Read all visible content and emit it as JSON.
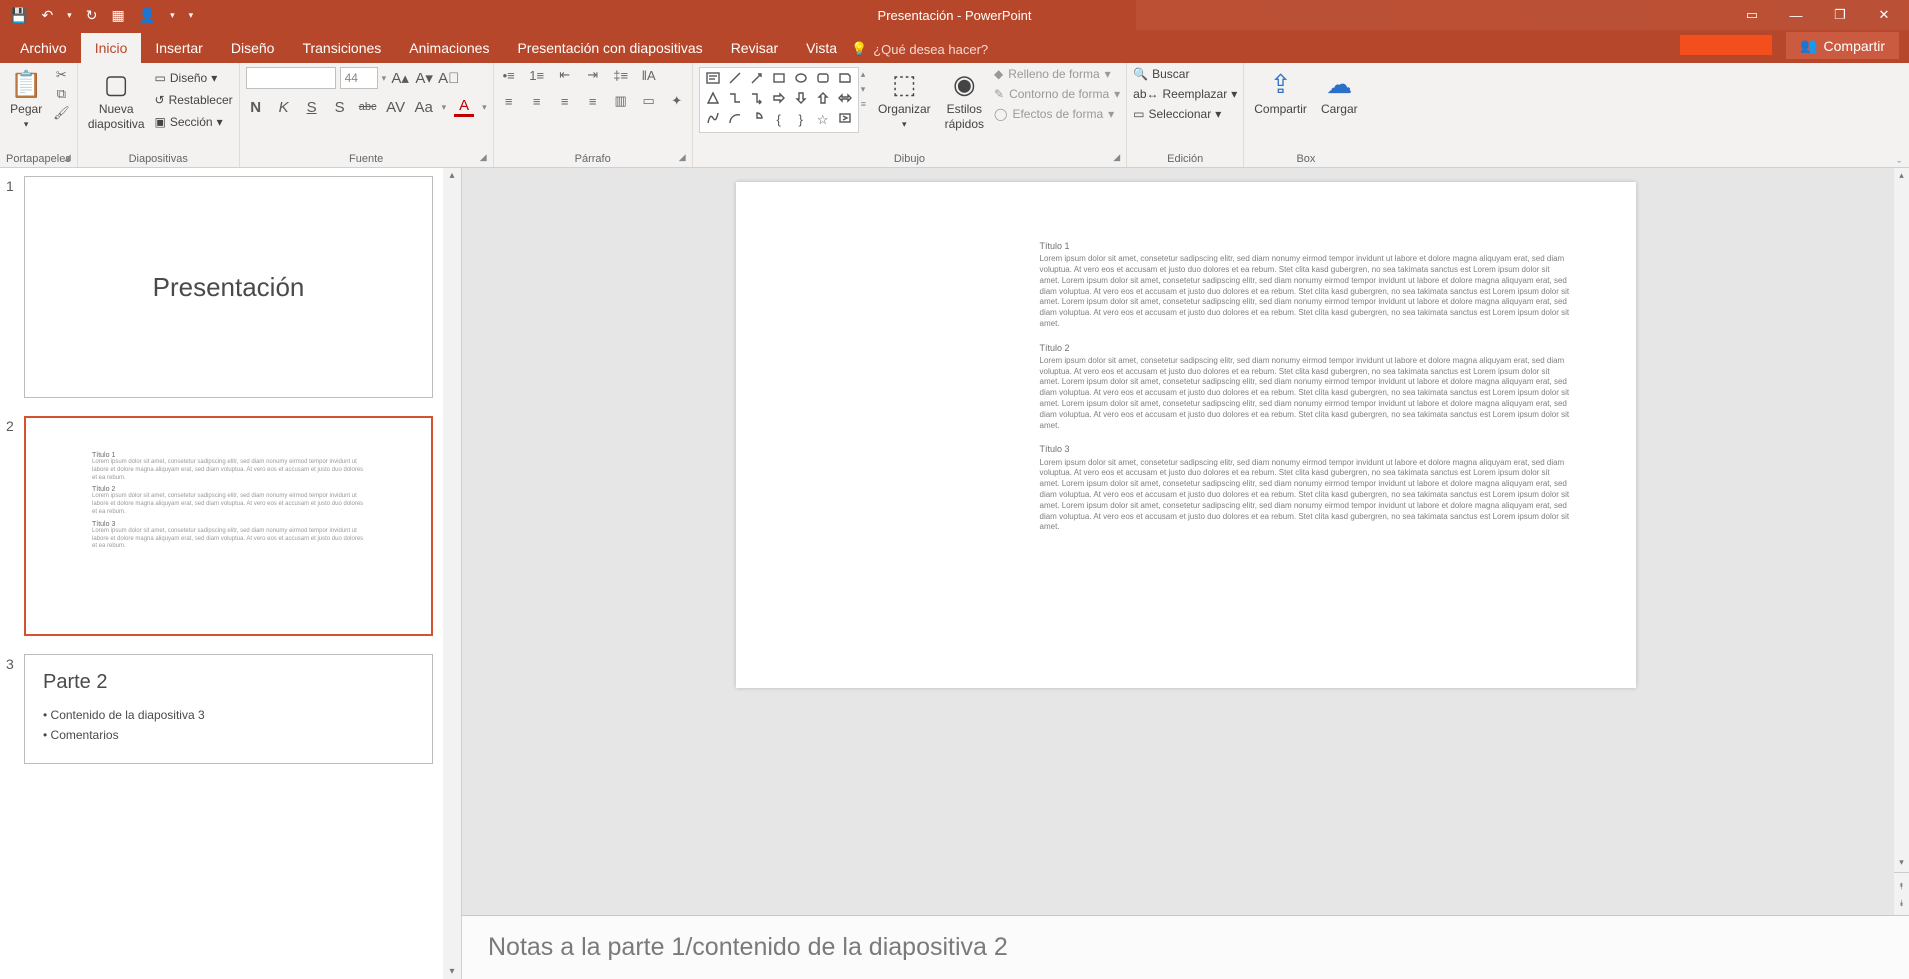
{
  "title": "Presentación - PowerPoint",
  "qat": {
    "save": "💾",
    "undo": "↶",
    "redo": "↻",
    "fromstart": "▦",
    "touch": "👤",
    "dd1": "▾",
    "dd2": "▾"
  },
  "win": {
    "ribbonopts": "▭",
    "min": "—",
    "max": "❐",
    "close": "✕"
  },
  "tabs": {
    "file": "Archivo",
    "home": "Inicio",
    "insert": "Insertar",
    "design": "Diseño",
    "transitions": "Transiciones",
    "animations": "Animaciones",
    "slideshow": "Presentación con diapositivas",
    "review": "Revisar",
    "view": "Vista"
  },
  "tellme": {
    "icon": "💡",
    "text": "¿Qué desea hacer?"
  },
  "share": {
    "icon": "👥",
    "label": "Compartir"
  },
  "groups": {
    "clipboard": {
      "label": "Portapapeles",
      "paste": "Pegar",
      "cut": "✂",
      "copy": "⧉",
      "painter": "🖌"
    },
    "slides": {
      "label": "Diapositivas",
      "new": "Nueva\ndiapositiva",
      "layout": "Diseño",
      "reset": "Restablecer",
      "section": "Sección"
    },
    "font": {
      "label": "Fuente",
      "size": "44",
      "bold": "N",
      "italic": "K",
      "underline": "S",
      "shadow": "S",
      "strike": "abc",
      "spacing": "AV",
      "case": "Aa",
      "color": "A"
    },
    "paragraph": {
      "label": "Párrafo"
    },
    "drawing": {
      "label": "Dibujo",
      "arrange": "Organizar",
      "quickstyles": "Estilos\nrápidos",
      "fill": "Relleno de forma",
      "outline": "Contorno de forma",
      "effects": "Efectos de forma"
    },
    "editing": {
      "label": "Edición",
      "find": "Buscar",
      "replace": "Reemplazar",
      "select": "Seleccionar"
    },
    "box": {
      "label": "Box",
      "share": "Compartir",
      "upload": "Cargar"
    }
  },
  "thumbs": {
    "s1": {
      "num": "1",
      "title": "Presentación"
    },
    "s2": {
      "num": "2",
      "titles": [
        "Título 1",
        "Título 2",
        "Título 3"
      ],
      "body": "Lorem ipsum dolor sit amet, consetetur sadipscing elitr, sed diam nonumy eirmod tempor invidunt ut labore et dolore magna aliquyam erat, sed diam voluptua. At vero eos et accusam et justo duo dolores et ea rebum."
    },
    "s3": {
      "num": "3",
      "title": "Parte 2",
      "b1": "• Contenido de la diapositiva 3",
      "b2": "• Comentarios"
    }
  },
  "slide": {
    "t1": "Título 1",
    "b1": "Lorem ipsum dolor sit amet, consetetur sadipscing elitr, sed diam nonumy eirmod tempor invidunt ut labore et dolore magna aliquyam erat, sed diam voluptua. At vero eos et accusam et justo duo dolores et ea rebum. Stet clita kasd gubergren, no sea takimata sanctus est Lorem ipsum dolor sit amet. Lorem ipsum dolor sit amet, consetetur sadipscing elitr, sed diam nonumy eirmod tempor invidunt ut labore et dolore magna aliquyam erat, sed diam voluptua. At vero eos et accusam et justo duo dolores et ea rebum. Stet clita kasd gubergren, no sea takimata sanctus est Lorem ipsum dolor sit amet. Lorem ipsum dolor sit amet, consetetur sadipscing elitr, sed diam nonumy eirmod tempor invidunt ut labore et dolore magna aliquyam erat, sed diam voluptua. At vero eos et accusam et justo duo dolores et ea rebum. Stet clita kasd gubergren, no sea takimata sanctus est Lorem ipsum dolor sit amet.",
    "t2": "Título 2",
    "b2": "Lorem ipsum dolor sit amet, consetetur sadipscing elitr, sed diam nonumy eirmod tempor invidunt ut labore et dolore magna aliquyam erat, sed diam voluptua. At vero eos et accusam et justo duo dolores et ea rebum. Stet clita kasd gubergren, no sea takimata sanctus est Lorem ipsum dolor sit amet. Lorem ipsum dolor sit amet, consetetur sadipscing elitr, sed diam nonumy eirmod tempor invidunt ut labore et dolore magna aliquyam erat, sed diam voluptua. At vero eos et accusam et justo duo dolores et ea rebum. Stet clita kasd gubergren, no sea takimata sanctus est Lorem ipsum dolor sit amet. Lorem ipsum dolor sit amet, consetetur sadipscing elitr, sed diam nonumy eirmod tempor invidunt ut labore et dolore magna aliquyam erat, sed diam voluptua. At vero eos et accusam et justo duo dolores et ea rebum. Stet clita kasd gubergren, no sea takimata sanctus est Lorem ipsum dolor sit amet.",
    "t3": "Título 3",
    "b3": "Lorem ipsum dolor sit amet, consetetur sadipscing elitr, sed diam nonumy eirmod tempor invidunt ut labore et dolore magna aliquyam erat, sed diam voluptua. At vero eos et accusam et justo duo dolores et ea rebum. Stet clita kasd gubergren, no sea takimata sanctus est Lorem ipsum dolor sit amet. Lorem ipsum dolor sit amet, consetetur sadipscing elitr, sed diam nonumy eirmod tempor invidunt ut labore et dolore magna aliquyam erat, sed diam voluptua. At vero eos et accusam et justo duo dolores et ea rebum. Stet clita kasd gubergren, no sea takimata sanctus est Lorem ipsum dolor sit amet. Lorem ipsum dolor sit amet, consetetur sadipscing elitr, sed diam nonumy eirmod tempor invidunt ut labore et dolore magna aliquyam erat, sed diam voluptua. At vero eos et accusam et justo duo dolores et ea rebum. Stet clita kasd gubergren, no sea takimata sanctus est Lorem ipsum dolor sit amet."
  },
  "notes": "Notas a la parte 1/contenido de la diapositiva 2"
}
